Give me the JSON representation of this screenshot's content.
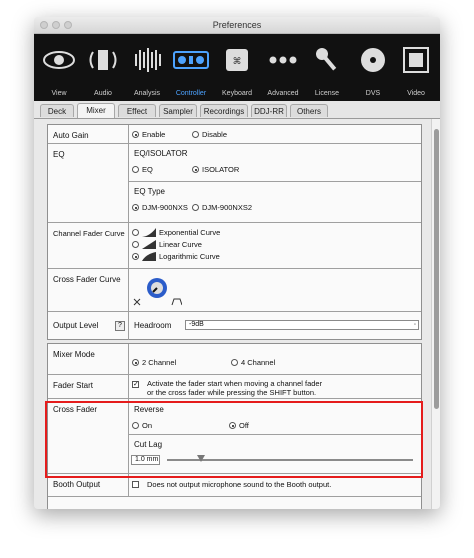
{
  "window": {
    "title": "Preferences"
  },
  "toolbar": {
    "items": [
      {
        "label": "View",
        "icon": "eye-icon"
      },
      {
        "label": "Audio",
        "icon": "speaker-icon"
      },
      {
        "label": "Analysis",
        "icon": "waveform-icon"
      },
      {
        "label": "Controller",
        "icon": "controller-icon",
        "active": true
      },
      {
        "label": "Keyboard",
        "icon": "keyboard-icon"
      },
      {
        "label": "Advanced",
        "icon": "dots-icon"
      },
      {
        "label": "License",
        "icon": "key-icon"
      },
      {
        "label": "DVS",
        "icon": "vinyl-icon"
      },
      {
        "label": "Video",
        "icon": "film-icon"
      }
    ],
    "active_color": "#4da3ff"
  },
  "tabs": [
    "Deck",
    "Mixer",
    "Effect",
    "Sampler",
    "Recordings",
    "DDJ-RR",
    "Others"
  ],
  "active_tab": "Mixer",
  "mixer": {
    "auto_gain": {
      "label": "Auto Gain",
      "enable": "Enable",
      "disable": "Disable"
    },
    "eq": {
      "label": "EQ",
      "isolator_heading": "EQ/ISOLATOR",
      "eq_option": "EQ",
      "isolator_option": "ISOLATOR",
      "eq_type_heading": "EQ Type",
      "type_a": "DJM-900NXS",
      "type_b": "DJM-900NXS2"
    },
    "channel_fader_curve": {
      "label": "Channel Fader Curve",
      "exponential": "Exponential Curve",
      "linear": "Linear Curve",
      "logarithmic": "Logarithmic Curve"
    },
    "cross_fader_curve": {
      "label": "Cross Fader Curve"
    },
    "output_level": {
      "label": "Output Level",
      "help": "?",
      "headroom_label": "Headroom",
      "headroom_value": "-9dB"
    }
  },
  "mixer2": {
    "mixer_mode": {
      "label": "Mixer Mode",
      "two": "2 Channel",
      "four": "4 Channel"
    },
    "fader_start": {
      "label": "Fader Start",
      "line1": "Activate the fader start when moving a channel fader",
      "line2": "or the cross fader while pressing the SHIFT button."
    },
    "cross_fader": {
      "label": "Cross Fader",
      "reverse_heading": "Reverse",
      "on": "On",
      "off": "Off",
      "cut_lag_heading": "Cut Lag",
      "cut_lag_value": "1.0 mm",
      "cut_lag_fraction": 0.14
    },
    "booth_output": {
      "label": "Booth Output",
      "text": "Does not output microphone sound to the Booth output."
    }
  },
  "colors": {
    "highlight": "#e51c1c",
    "knob": "#2b5cc9"
  }
}
